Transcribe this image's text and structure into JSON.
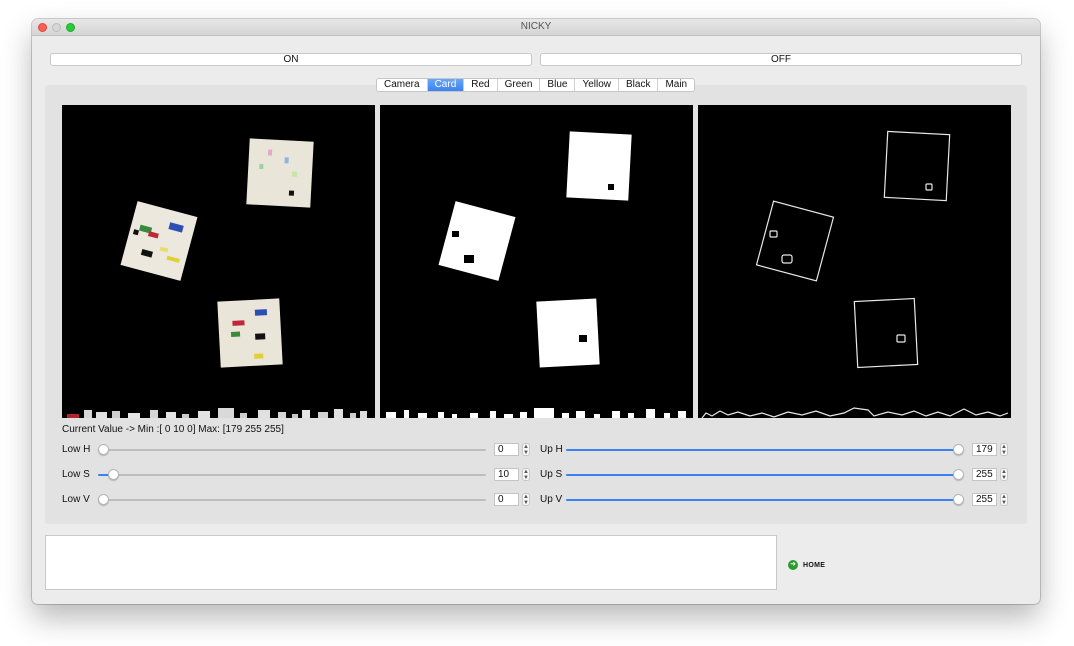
{
  "window": {
    "title": "NICKY"
  },
  "controls": {
    "on_label": "ON",
    "off_label": "OFF"
  },
  "tabs": [
    {
      "label": "Camera",
      "active": false
    },
    {
      "label": "Card",
      "active": true
    },
    {
      "label": "Red",
      "active": false
    },
    {
      "label": "Green",
      "active": false
    },
    {
      "label": "Blue",
      "active": false
    },
    {
      "label": "Yellow",
      "active": false
    },
    {
      "label": "Black",
      "active": false
    },
    {
      "label": "Main",
      "active": false
    }
  ],
  "status": {
    "current_value": "Current Value -> Min :[ 0 10  0] Max: [179 255 255]"
  },
  "sliders": {
    "low_h": {
      "label": "Low H",
      "value": "0",
      "fraction": 0
    },
    "low_s": {
      "label": "Low S",
      "value": "10",
      "fraction": 0.04
    },
    "low_v": {
      "label": "Low V",
      "value": "0",
      "fraction": 0
    },
    "up_h": {
      "label": "Up H",
      "value": "179",
      "fraction": 1
    },
    "up_s": {
      "label": "Up S",
      "value": "255",
      "fraction": 1
    },
    "up_v": {
      "label": "Up V",
      "value": "255",
      "fraction": 1
    }
  },
  "home": {
    "label": "HOME",
    "icon": "arrow-right-circle-icon"
  },
  "colors": {
    "accent": "#3b82f0",
    "home_icon": "#2e9a2e"
  }
}
